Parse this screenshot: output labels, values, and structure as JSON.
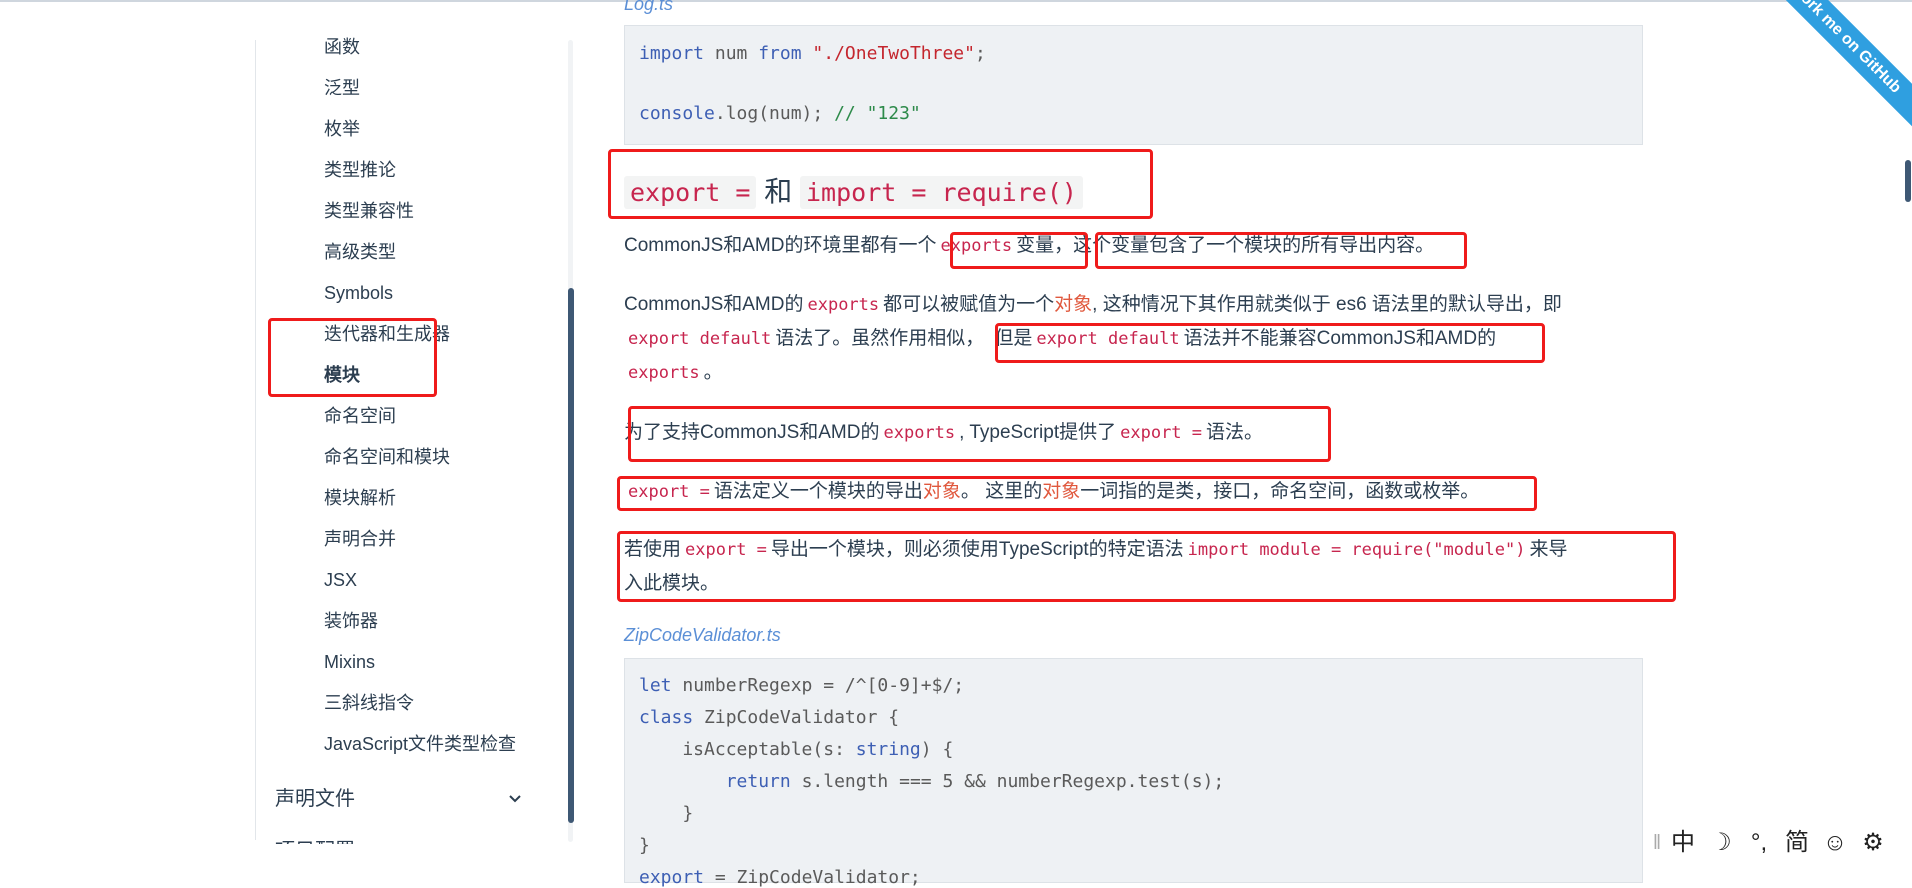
{
  "sidebar": {
    "items": [
      {
        "label": "函数",
        "active": false
      },
      {
        "label": "泛型",
        "active": false
      },
      {
        "label": "枚举",
        "active": false
      },
      {
        "label": "类型推论",
        "active": false
      },
      {
        "label": "类型兼容性",
        "active": false
      },
      {
        "label": "高级类型",
        "active": false
      },
      {
        "label": "Symbols",
        "active": false
      },
      {
        "label": "迭代器和生成器",
        "active": false
      },
      {
        "label": "模块",
        "active": true
      },
      {
        "label": "命名空间",
        "active": false
      },
      {
        "label": "命名空间和模块",
        "active": false
      },
      {
        "label": "模块解析",
        "active": false
      },
      {
        "label": "声明合并",
        "active": false
      },
      {
        "label": "JSX",
        "active": false
      },
      {
        "label": "装饰器",
        "active": false
      },
      {
        "label": "Mixins",
        "active": false
      },
      {
        "label": "三斜线指令",
        "active": false
      },
      {
        "label": "JavaScript文件类型检查",
        "active": false
      }
    ],
    "group_label": "声明文件",
    "next_group_label": "项目配置"
  },
  "log_file_label": "Log.ts",
  "code_log": {
    "line1_kw1": "import",
    "line1_mid": " num ",
    "line1_kw2": "from",
    "line1_str": "\"./OneTwoThree\"",
    "line1_end": ";",
    "line2_kw": "console",
    "line2_mid": ".log(num); ",
    "line2_cm": "// \"123\""
  },
  "heading": {
    "code1": "export =",
    "and": "和",
    "code2": "import = require()"
  },
  "p1": {
    "t1": "CommonJS和AMD的环境里都有一个",
    "c1": "exports",
    "t2": "变量，",
    "t3": "这个变量包含了一个模块的所有导出内容。"
  },
  "p2": {
    "t1": "CommonJS和AMD的",
    "c1": "exports",
    "t2": "都可以被赋值为一个",
    "l1": "对象",
    "t3": ", 这种情况下其作用就类似于 es6 语法里的默认导出，即",
    "c2": "export default",
    "t4": "语法了。虽然作用相似，",
    "t5": "但是",
    "c3": "export default",
    "t6": "语法并不能兼容CommonJS和AMD的",
    "c4": "exports",
    "t7": "。"
  },
  "p3": {
    "t1": "为了支持CommonJS和AMD的",
    "c1": "exports",
    "t2": ", TypeScript提供了",
    "c2": "export =",
    "t3": "语法。"
  },
  "p4": {
    "c1": "export =",
    "t1": "语法定义一个模块的导出",
    "l1": "对象",
    "t2": "。 这里的",
    "l2": "对象",
    "t3": "一词指的是类，接口，命名空间，函数或枚举。"
  },
  "p5": {
    "t1": "若使用",
    "c1": "export =",
    "t2": "导出一个模块，则必须使用TypeScript的特定语法",
    "c2": "import module = require(\"module\")",
    "t3": "来导",
    "t4": "入此模块。"
  },
  "zip_file_label": "ZipCodeValidator.ts",
  "code_zip": {
    "l1_kw": "let",
    "l1_rest": " numberRegexp = /^[0-9]+$/;",
    "l2_kw": "class",
    "l2_rest": " ZipCodeValidator {",
    "l3_a": "    isAcceptable(s: ",
    "l3_kw": "string",
    "l3_b": ") {",
    "l4_indent": "        ",
    "l4_kw": "return",
    "l4_rest": " s.length === 5 && numberRegexp.test(s);",
    "l5": "    }",
    "l6": "}",
    "l7_kw": "export",
    "l7_rest": " = ZipCodeValidator;"
  },
  "ribbon_text": "Fork me on GitHub",
  "ime": {
    "mode": "中",
    "moon": "☽",
    "punct": "°,",
    "simp": "简",
    "emoji": "☺",
    "gear": "⚙"
  },
  "colors": {
    "annotation_red": "#ef1b1b",
    "inline_code": "#c7254e",
    "keyword": "#3d5fb4",
    "string": "#c4262e",
    "comment": "#2d8a4a",
    "ribbon": "#2f9fe0",
    "scroll_thumb": "#3e5874"
  }
}
